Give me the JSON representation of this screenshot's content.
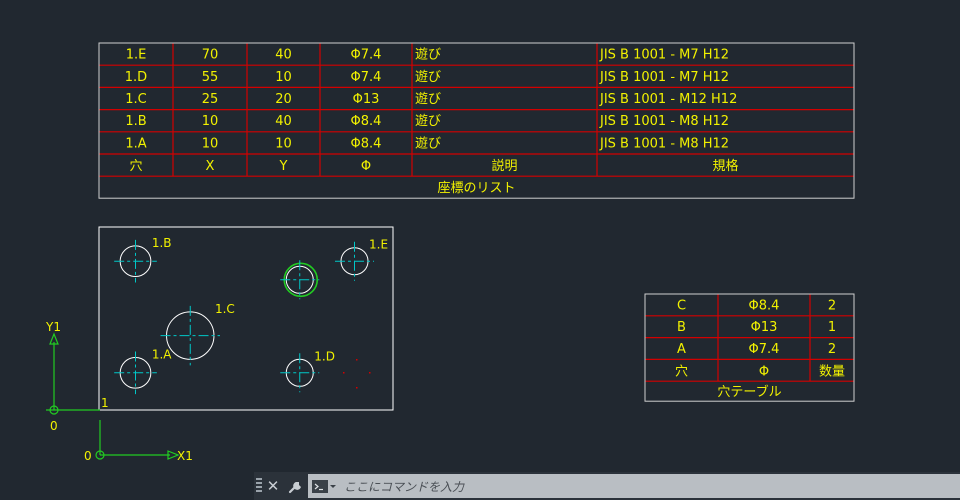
{
  "colors": {
    "background": "#212830",
    "table_border": "#cfcfcf",
    "table_grid": "#d40000",
    "text": "#f2f200",
    "part_outline": "#ffffff",
    "hole": "#ffffff",
    "centerline": "#00c8c8",
    "selected_hole": "#22cc22",
    "axis": "#22cc22"
  },
  "coord_table": {
    "title": "座標のリスト",
    "headers": [
      "穴",
      "X",
      "Y",
      "Φ",
      "説明",
      "規格"
    ],
    "rows": [
      [
        "1.E",
        "70",
        "40",
        "Φ7.4",
        "遊び",
        "JIS B 1001 - M7  H12"
      ],
      [
        "1.D",
        "55",
        "10",
        "Φ7.4",
        "遊び",
        "JIS B 1001 - M7  H12"
      ],
      [
        "1.C",
        "25",
        "20",
        "Φ13",
        "遊び",
        "JIS B 1001 - M12  H12"
      ],
      [
        "1.B",
        "10",
        "40",
        "Φ8.4",
        "遊び",
        "JIS B 1001 - M8  H12"
      ],
      [
        "1.A",
        "10",
        "10",
        "Φ8.4",
        "遊び",
        "JIS B 1001 - M8  H12"
      ]
    ]
  },
  "hole_table": {
    "title": "穴テーブル",
    "headers": [
      "穴",
      "Φ",
      "数量"
    ],
    "rows": [
      [
        "C",
        "Φ8.4",
        "2"
      ],
      [
        "B",
        "Φ13",
        "1"
      ],
      [
        "A",
        "Φ7.4",
        "2"
      ]
    ]
  },
  "part": {
    "origin_label": "1",
    "holes": [
      {
        "label": "1.A",
        "x": 10,
        "y": 10,
        "diameter": 8.4,
        "selected": false
      },
      {
        "label": "1.B",
        "x": 10,
        "y": 40,
        "diameter": 8.4,
        "selected": false
      },
      {
        "label": "1.C",
        "x": 25,
        "y": 20,
        "diameter": 13,
        "selected": false
      },
      {
        "label": "1.D",
        "x": 55,
        "y": 10,
        "diameter": 7.4,
        "selected": false
      },
      {
        "label": "1.E",
        "x": 70,
        "y": 40,
        "diameter": 7.4,
        "selected": false
      },
      {
        "label": "",
        "x": 55,
        "y": 35,
        "diameter": 7.4,
        "selected": true
      }
    ]
  },
  "ucs": {
    "y_label": "Y1",
    "origin_label": "0",
    "x_label": "X1",
    "origin2_label": "0"
  },
  "command_line": {
    "close_glyph": "✕",
    "placeholder": "ここにコマンドを入力"
  }
}
